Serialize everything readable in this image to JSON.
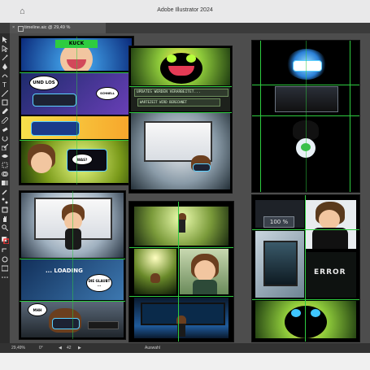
{
  "app": {
    "title": "Adobe Illustrator 2024"
  },
  "document_tab": {
    "label": "timeline.aic @ 29,49 % (CMYK/Vorschau)"
  },
  "status_bar": {
    "zoom": "29,49%",
    "rotation": "0°",
    "artboard_number": "42",
    "tool_name": "Auswahl"
  },
  "comic": {
    "panel1_sign": "KUCK",
    "panel1_bubble": "UND LOS",
    "panel1_small_bubble": "SCHNELL",
    "panel1_small_bubble2": "WAS?",
    "panel2_banner": "UPDATES WERDEN VERARBEITET...",
    "panel2_sub": "WARTEZEIT WIRD BERECHNET",
    "panel3_loading": "... LOADING",
    "panel3_bubble": "DIE GLAUBT ...",
    "panel3_bubble2": "MHH",
    "panel5_display": "100 %",
    "panel5_error": "ERROR"
  },
  "colors": {
    "ui_dark": "#2b2b2b",
    "canvas": "#4d4d4d",
    "guide_green": "#2ecc40",
    "neon_green": "#b6ff3b",
    "neon_blue": "#3fc6ff"
  }
}
